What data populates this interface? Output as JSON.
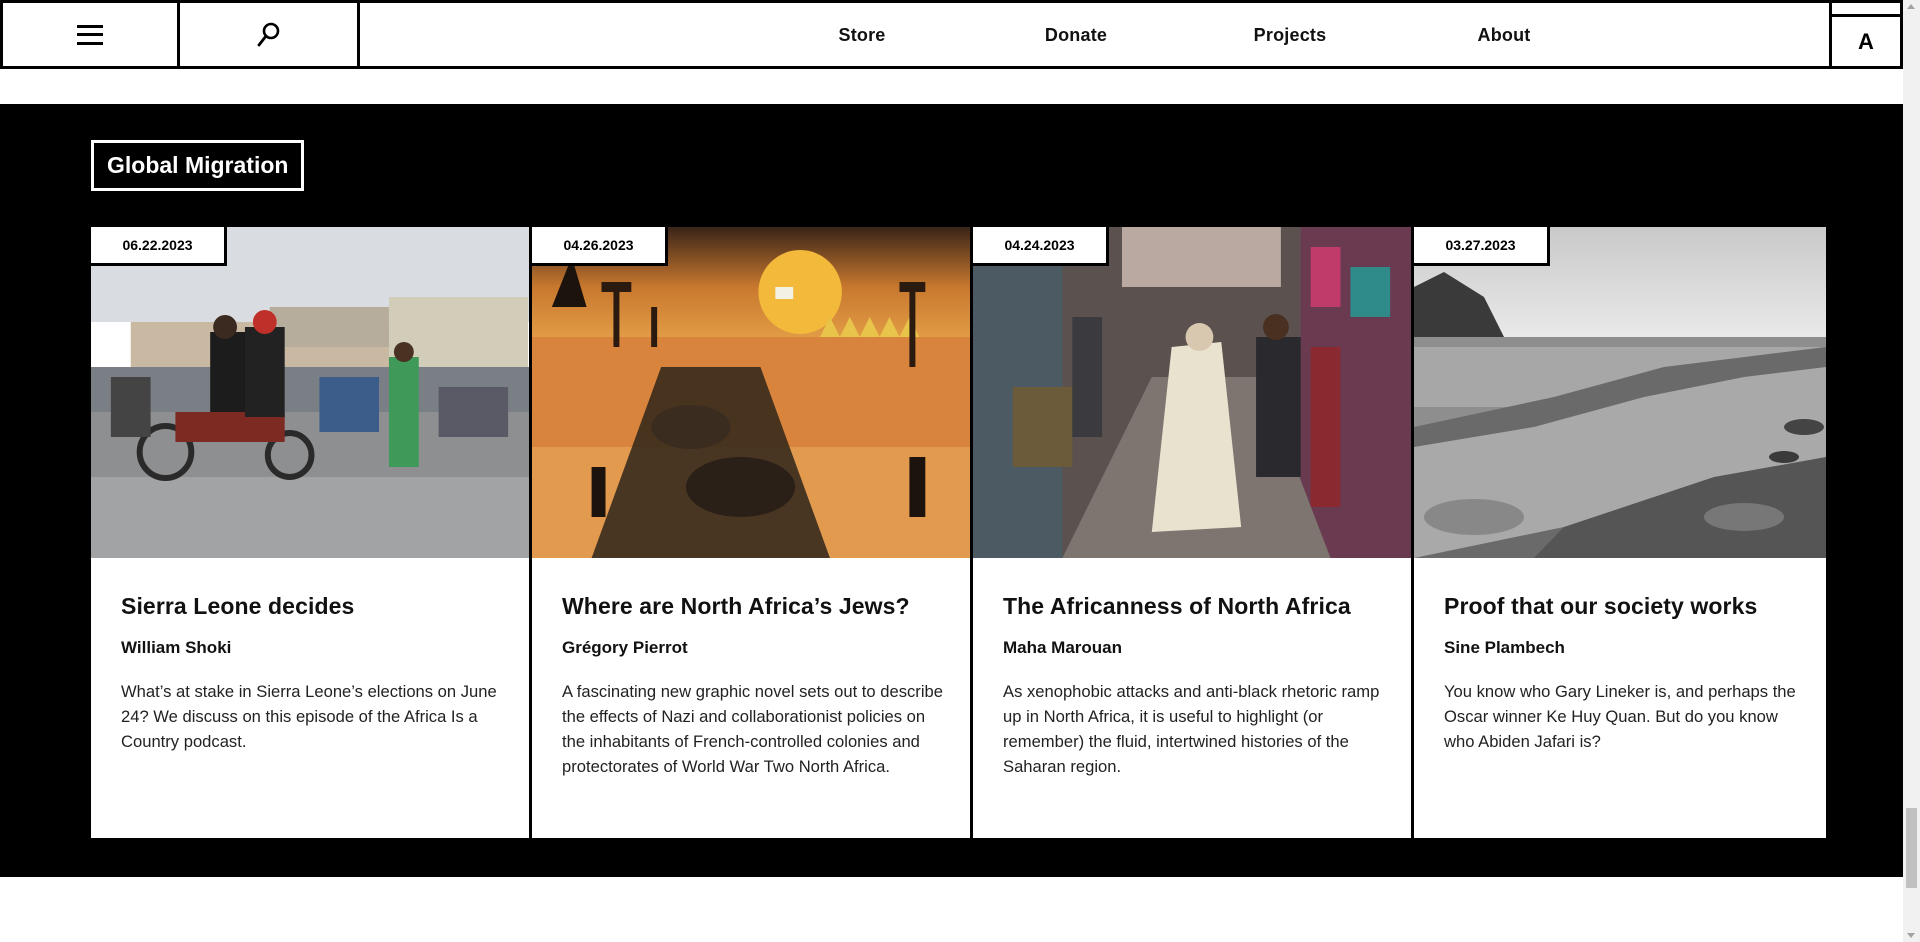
{
  "header": {
    "nav": [
      {
        "label": "Store"
      },
      {
        "label": "Donate"
      },
      {
        "label": "Projects"
      },
      {
        "label": "About"
      }
    ],
    "accessibility_button": "A",
    "icons": {
      "menu": "hamburger-menu-icon",
      "search": "search-icon"
    }
  },
  "section": {
    "title": "Global Migration"
  },
  "articles": [
    {
      "date": "06.22.2023",
      "title": "Sierra Leone decides",
      "author": "William Shoki",
      "description": "What’s at stake in Sierra Leone’s elections on June 24? We discuss on this episode of the Africa Is a Country podcast.",
      "image": "photo-motorcycles-street"
    },
    {
      "date": "04.26.2023",
      "title": "Where are North Africa’s Jews?",
      "author": "Grégory Pierrot",
      "description": "A fascinating new graphic novel sets out to describe the effects of Nazi and collaborationist policies on the inhabitants of French-controlled colonies and protectorates of World War Two North Africa.",
      "image": "illustration-desert-camp"
    },
    {
      "date": "04.24.2023",
      "title": "The Africanness of North Africa",
      "author": "Maha Marouan",
      "description": "As xenophobic attacks and anti-black rhetoric ramp up in North Africa, it is useful to highlight (or remember) the fluid, intertwined histories of the Saharan region.",
      "image": "photo-market-street"
    },
    {
      "date": "03.27.2023",
      "title": "Proof that our society works",
      "author": "Sine Plambech",
      "description": "You know who Gary Lineker is, and perhaps the Oscar winner Ke Huy Quan. But do you know who Abiden Jafari is?",
      "image": "photo-rocky-coast-bw"
    }
  ]
}
